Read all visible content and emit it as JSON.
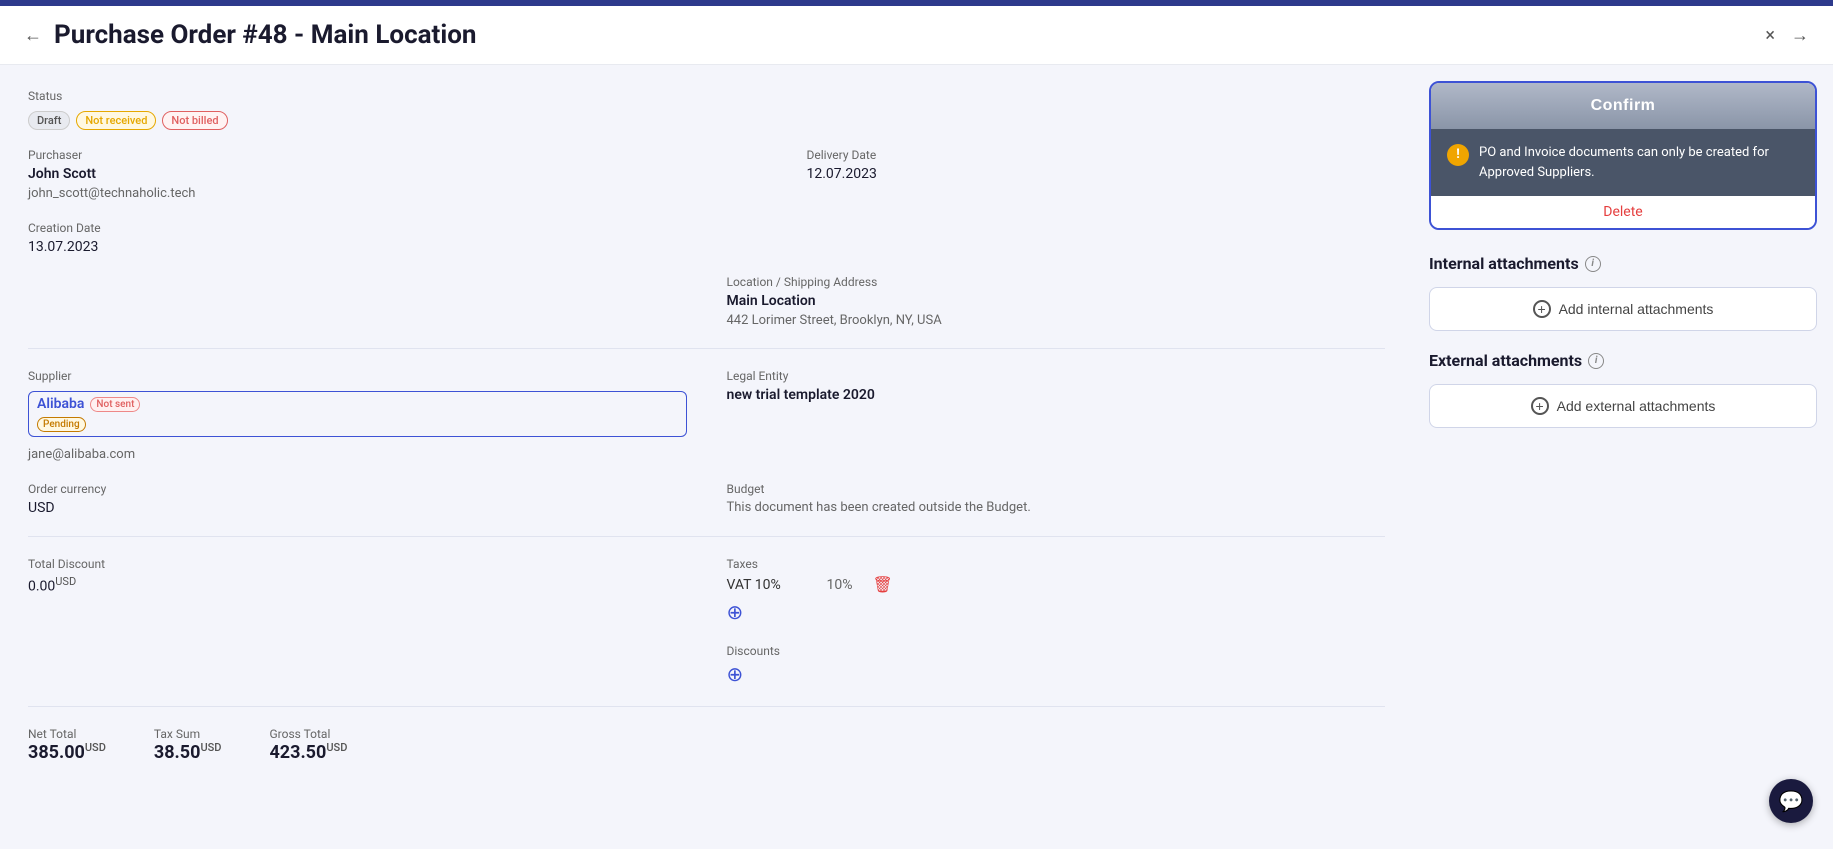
{
  "topBar": {},
  "header": {
    "title": "Purchase Order #48 - Main Location",
    "backLabel": "←",
    "closeLabel": "×",
    "nextLabel": "→"
  },
  "status": {
    "label": "Status",
    "badges": [
      {
        "text": "Draft",
        "type": "draft"
      },
      {
        "text": "Not received",
        "type": "not-received"
      },
      {
        "text": "Not billed",
        "type": "not-billed"
      }
    ]
  },
  "purchaser": {
    "label": "Purchaser",
    "name": "John Scott",
    "email": "john_scott@technaholic.tech"
  },
  "supplier": {
    "label": "Supplier",
    "name": "Alibaba",
    "badge_not_sent": "Not sent",
    "badge_pending": "Pending",
    "email": "jane@alibaba.com"
  },
  "orderCurrency": {
    "label": "Order currency",
    "value": "USD"
  },
  "totalDiscount": {
    "label": "Total Discount",
    "value": "0.00",
    "currency": "USD"
  },
  "netTotal": {
    "label": "Net Total",
    "value": "385.00",
    "currency": "USD"
  },
  "taxSum": {
    "label": "Tax Sum",
    "value": "38.50",
    "currency": "USD"
  },
  "grossTotal": {
    "label": "Gross Total",
    "value": "423.50",
    "currency": "USD"
  },
  "creationDate": {
    "label": "Creation Date",
    "value": "13.07.2023"
  },
  "deliveryDate": {
    "label": "Delivery Date",
    "value": "12.07.2023"
  },
  "location": {
    "label": "Location / Shipping Address",
    "name": "Main Location",
    "address": "442 Lorimer Street, Brooklyn, NY, USA"
  },
  "legalEntity": {
    "label": "Legal Entity",
    "value": "new trial template 2020"
  },
  "budget": {
    "label": "Budget",
    "value": "This document has been created outside the Budget."
  },
  "taxes": {
    "label": "Taxes",
    "items": [
      {
        "name": "VAT 10%",
        "percent": "10%"
      }
    ]
  },
  "discounts": {
    "label": "Discounts"
  },
  "rightPanel": {
    "confirmButton": "Confirm",
    "warningText": "PO and Invoice documents can only be created for Approved Suppliers.",
    "deleteLabel": "Delete",
    "internalAttachments": {
      "heading": "Internal attachments",
      "addLabel": "Add internal attachments"
    },
    "externalAttachments": {
      "heading": "External attachments",
      "addLabel": "Add external attachments"
    }
  }
}
